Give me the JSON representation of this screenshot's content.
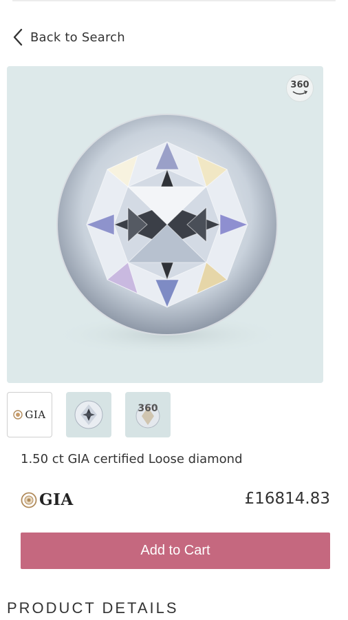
{
  "nav": {
    "back_label": "Back to Search"
  },
  "media": {
    "badge_360": "360",
    "thumbs": [
      {
        "kind": "certificate",
        "label": "GIA"
      },
      {
        "kind": "photo"
      },
      {
        "kind": "video-360",
        "label": "360"
      }
    ]
  },
  "product": {
    "title": "1.50 ct GIA certified Loose diamond",
    "lab": "GIA",
    "price": "£16814.83",
    "add_to_cart_label": "Add to Cart"
  },
  "section": {
    "details_heading": "PRODUCT DETAILS"
  },
  "colors": {
    "accent": "#c5687f",
    "image_bg": "#dde9ea"
  }
}
